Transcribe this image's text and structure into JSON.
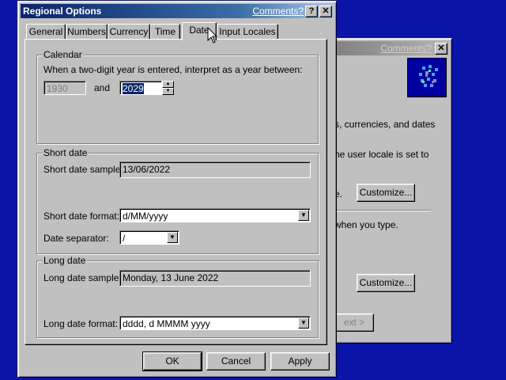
{
  "back_window": {
    "comments": "Comments?",
    "text1": "s, currencies, and dates",
    "text2": "he user locale is set to",
    "text3": "e.",
    "customize1": "Customize...",
    "text4": "when you type.",
    "customize2": "Customize...",
    "next": "ext >"
  },
  "dialog": {
    "title": "Regional Options",
    "comments": "Comments?",
    "help_glyph": "?",
    "close_glyph": "✕",
    "tabs": [
      "General",
      "Numbers",
      "Currency",
      "Time",
      "Date",
      "Input Locales"
    ],
    "calendar": {
      "title": "Calendar",
      "prompt": "When a two-digit year is entered, interpret as a year between:",
      "from": "1930",
      "and": "and",
      "to": "2029"
    },
    "short_date": {
      "title": "Short date",
      "sample_label": "Short date sample:",
      "sample": "13/06/2022",
      "format_label": "Short date format:",
      "format": "d/MM/yyyy",
      "separator_label": "Date separator:",
      "separator": "/"
    },
    "long_date": {
      "title": "Long date",
      "sample_label": "Long date sample:",
      "sample": "Monday, 13 June 2022",
      "format_label": "Long date format:",
      "format": "dddd, d MMMM yyyy"
    },
    "buttons": {
      "ok": "OK",
      "cancel": "Cancel",
      "apply": "Apply"
    }
  }
}
